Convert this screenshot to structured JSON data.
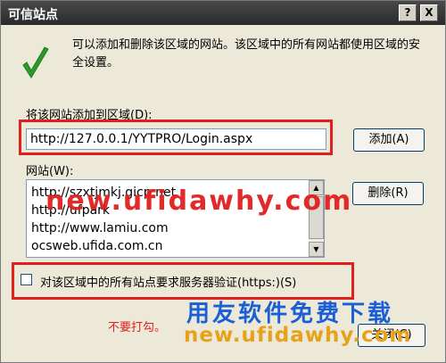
{
  "dialog": {
    "title": "可信站点",
    "help_glyph": "?",
    "close_glyph": "X",
    "icon": "green-checkmark-icon",
    "description": "可以添加和删除该区域的网站。该区域中的所有网站都使用区域的安全设置。"
  },
  "add_section": {
    "label": "将该网站添加到区域(D):",
    "url_value": "http://127.0.0.1/YYTPRO/Login.aspx",
    "add_button": "添加(A)"
  },
  "sites_section": {
    "label": "网站(W):",
    "items": [
      "http://szxtjmkj.gicp.net",
      "http://ufpark",
      "http://www.lamiu.com",
      "ocsweb.ufida.com.cn"
    ],
    "remove_button": "删除(R)"
  },
  "https_option": {
    "checked": false,
    "label": "对该区域中的所有站点要求服务器验证(https:)(S)"
  },
  "annotation_note": "不要打勾。",
  "close_button": "关闭(C)",
  "watermark": {
    "url": "new.ufidawhy.com",
    "chinese": "用友软件免费下载",
    "url_bottom": "new.ufidawhy.com"
  },
  "colors": {
    "highlight_red": "#e01f1f",
    "check_green": "#2a9a2a",
    "dialog_bg": "#ece9d8"
  }
}
